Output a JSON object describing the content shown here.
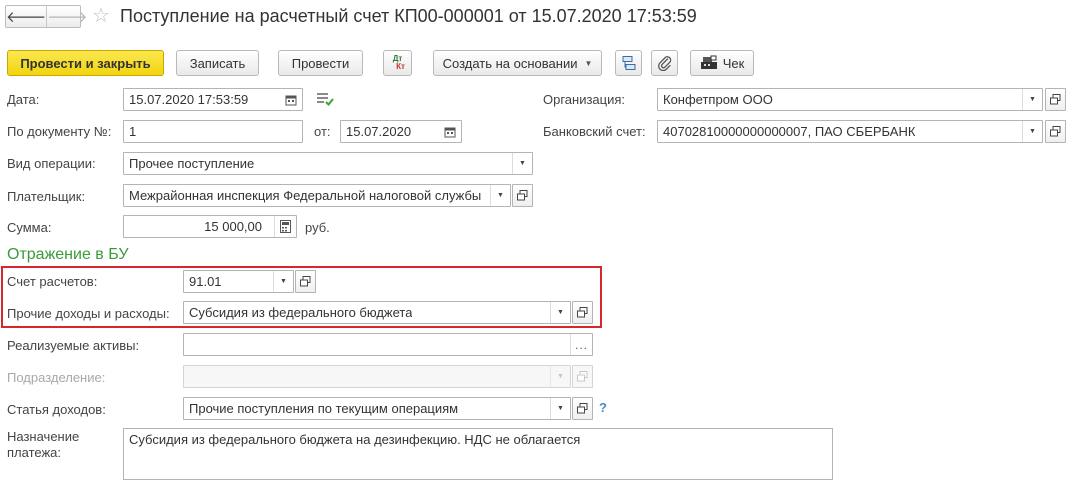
{
  "header": {
    "back_glyph": "🡐",
    "forward_glyph": "🡒",
    "star_glyph": "☆",
    "title": "Поступление на расчетный счет КП00-000001 от 15.07.2020 17:53:59"
  },
  "toolbar": {
    "post_close": "Провести и закрыть",
    "write": "Записать",
    "post": "Провести",
    "dtkt_top": "Дт",
    "dtkt_bottom": "Кт",
    "create_based": "Создать на основании",
    "check": "Чек"
  },
  "form": {
    "date": {
      "label": "Дата:",
      "value": "15.07.2020 17:53:59"
    },
    "doc_num": {
      "label": "По документу №:",
      "value": "1"
    },
    "from": {
      "label": "от:",
      "value": "15.07.2020"
    },
    "operation": {
      "label": "Вид операции:",
      "value": "Прочее поступление"
    },
    "payer": {
      "label": "Плательщик:",
      "value": "Межрайонная инспекция Федеральной налоговой службы"
    },
    "amount": {
      "label": "Сумма:",
      "value": "15 000,00",
      "currency": "руб."
    },
    "organization": {
      "label": "Организация:",
      "value": "Конфетпром ООО"
    },
    "bank_account": {
      "label": "Банковский счет:",
      "value": "40702810000000000007, ПАО СБЕРБАНК"
    }
  },
  "accounting": {
    "title": "Отражение в БУ",
    "settlement_account": {
      "label": "Счет расчетов:",
      "value": "91.01"
    },
    "other_income": {
      "label": "Прочие доходы и расходы:",
      "value": "Субсидия из федерального бюджета"
    },
    "assets": {
      "label": "Реализуемые активы:",
      "value": ""
    },
    "division": {
      "label": "Подразделение:",
      "value": ""
    },
    "income_item": {
      "label": "Статья доходов:",
      "value": "Прочие поступления по текущим операциям"
    },
    "help": "?",
    "purpose": {
      "label_line1": "Назначение",
      "label_line2": "платежа:",
      "value": "Субсидия из федерального бюджета на дезинфекцию. НДС не облагается"
    }
  },
  "colors": {
    "primary": "#f5d81a",
    "section": "#3c9a3c",
    "highlight": "#d4282e",
    "help": "#4a8cc9"
  }
}
